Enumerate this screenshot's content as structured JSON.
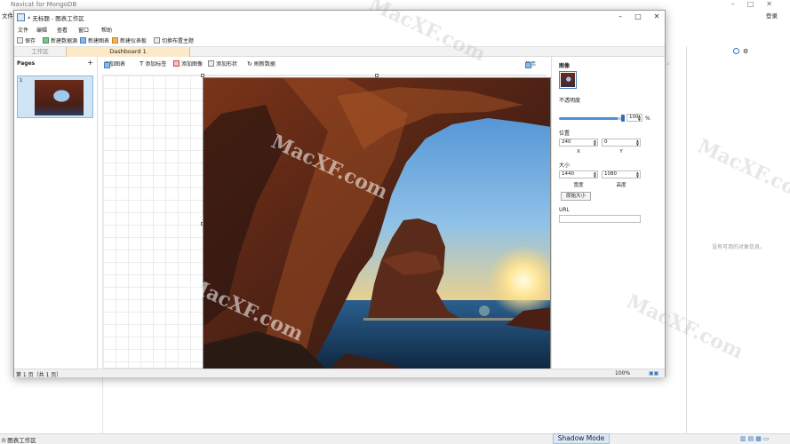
{
  "background_app": {
    "title": "Navicat for MongoDB",
    "menu_file": "文件",
    "login": "登录",
    "no_selection_text": "没有可用的对象信息。",
    "status_left": "0 图表工作区",
    "shadow_mode": "Shadow Mode"
  },
  "window": {
    "title": "* 无标题 - 图表工作区",
    "menu": [
      "文件",
      "编辑",
      "查看",
      "窗口",
      "帮助"
    ],
    "toolbar": {
      "save": "保存",
      "new_datasource": "新建数据源",
      "new_chart": "新建图表",
      "new_dashboard": "新建仪表板",
      "switch_theme": "切换布置主题"
    },
    "tabs": {
      "workspace": "工作区",
      "dashboard": "Dashboard 1"
    },
    "pages_panel": {
      "header": "Pages",
      "add": "+",
      "thumb_number": "1"
    },
    "canvas_toolbar": {
      "add_chart": "添加图表",
      "add_label": "添加标签",
      "add_image": "添加图像",
      "add_shape": "添加形状",
      "refresh": "刷新数据",
      "display": "显示"
    },
    "properties": {
      "section": "图像",
      "opacity_label": "不透明度",
      "opacity_value": "100",
      "opacity_unit": "%",
      "position_label": "位置",
      "x_value": "240",
      "y_value": "0",
      "x_caption": "X",
      "y_caption": "Y",
      "size_label": "大小",
      "width_value": "1440",
      "height_value": "1080",
      "width_caption": "宽度",
      "height_caption": "高度",
      "original_size_button": "原始大小",
      "url_label": "URL",
      "url_value": ""
    },
    "status": {
      "page_info": "第 1 页（共 1 页）",
      "zoom": "100%"
    }
  },
  "watermark": "MacXF.com",
  "colors": {
    "accent": "#4a90d9",
    "active_tab": "#fce9c7",
    "thumb_selected": "#cfe4f5"
  }
}
